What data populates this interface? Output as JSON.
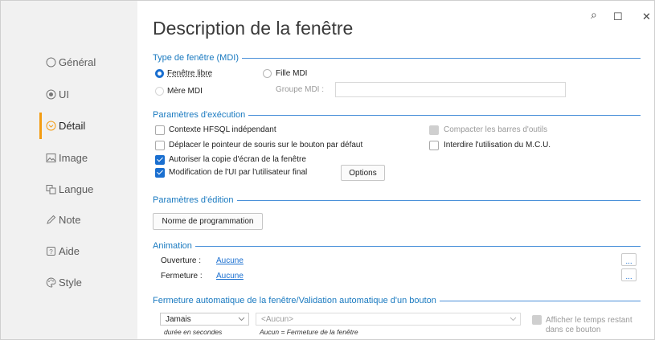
{
  "title": "Description de la fenêtre",
  "colors": {
    "accent": "#1a7ac0",
    "active_marker": "#f39c12",
    "checkbox_on": "#1a6fd0"
  },
  "window_controls": {
    "search": "⌕",
    "maximize": "☐",
    "close": "✕"
  },
  "sidebar": {
    "items": [
      {
        "label": "Général",
        "icon": "radio-icon"
      },
      {
        "label": "UI",
        "icon": "eye-icon"
      },
      {
        "label": "Détail",
        "icon": "detail-icon",
        "active": true
      },
      {
        "label": "Image",
        "icon": "image-icon"
      },
      {
        "label": "Langue",
        "icon": "language-icon"
      },
      {
        "label": "Note",
        "icon": "pencil-icon"
      },
      {
        "label": "Aide",
        "icon": "help-icon"
      },
      {
        "label": "Style",
        "icon": "palette-icon"
      }
    ]
  },
  "mdi": {
    "header": "Type de fenêtre (MDI)",
    "free_window": "Fenêtre libre",
    "mdi_child": "Fille MDI",
    "mdi_parent": "Mère MDI",
    "mdi_group_label": "Groupe MDI :",
    "mdi_group_value": "",
    "selected": "Fenêtre libre"
  },
  "execution": {
    "header": "Paramètres d'exécution",
    "hfsql_context": {
      "label": "Contexte HFSQL indépendant",
      "checked": false
    },
    "move_pointer": {
      "label": "Déplacer le pointeur de souris sur le bouton par défaut",
      "checked": false
    },
    "allow_screenshot": {
      "label": "Autoriser la copie d'écran de la fenêtre",
      "checked": true
    },
    "ui_modification": {
      "label": "Modification de l'UI par l'utilisateur final",
      "checked": true
    },
    "options_button": "Options",
    "compact_toolbars": {
      "label": "Compacter les barres d'outils",
      "checked": false,
      "disabled": true
    },
    "forbid_mcu": {
      "label": "Interdire l'utilisation du M.C.U.",
      "checked": false
    }
  },
  "editing": {
    "header": "Paramètres d'édition",
    "button": "Norme de programmation"
  },
  "animation": {
    "header": "Animation",
    "opening_label": "Ouverture :",
    "opening_value": "Aucune",
    "closing_label": "Fermeture :",
    "closing_value": "Aucune",
    "more": "..."
  },
  "auto_close": {
    "header": "Fermeture automatique de la fenêtre/Validation automatique d'un bouton",
    "duration_value": "Jamais",
    "duration_caption": "durée en secondes",
    "button_value": "<Aucun>",
    "button_caption": "Aucun = Fermeture de la fenêtre",
    "show_remaining": {
      "label_line1": "Afficher le temps restant",
      "label_line2": "dans ce bouton",
      "checked": false,
      "disabled": true
    }
  }
}
